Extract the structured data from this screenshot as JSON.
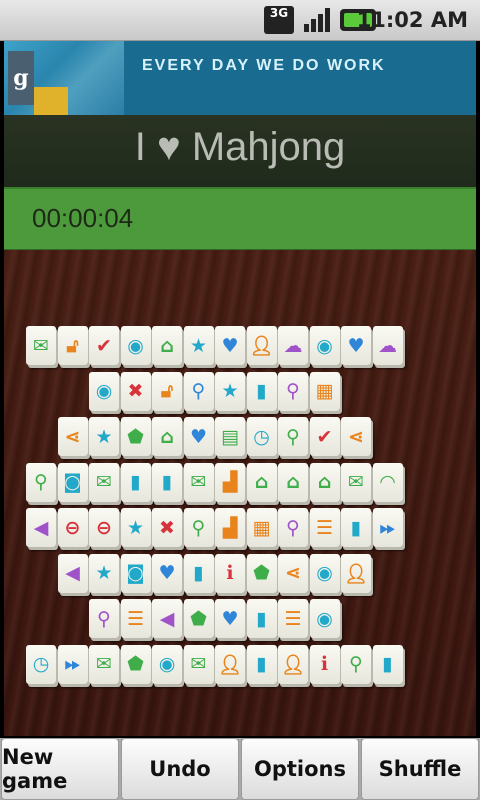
{
  "status_bar": {
    "network_label": "3G",
    "time": "11:02 AM"
  },
  "banner": {
    "logo_letter": "g",
    "tagline": "EVERY DAY WE DO WORK"
  },
  "header": {
    "title_left": "I",
    "title_right": "Mahjong"
  },
  "timer": {
    "value": "00:00:04"
  },
  "colors": {
    "green": "#3fae4a",
    "orange": "#e8841b",
    "red": "#d8333a",
    "teal": "#22a9c9",
    "blue": "#2f86d8",
    "purple": "#a052c8",
    "yellow": "#d7b52a"
  },
  "board": {
    "rows": [
      {
        "row": 0,
        "tiles": [
          {
            "icon": "envelope-icon",
            "glyph": "✉",
            "color": "green"
          },
          {
            "icon": "unlock-icon",
            "glyph": "🔓︎",
            "color": "orange"
          },
          {
            "icon": "check-circle-icon",
            "glyph": "✔",
            "color": "red"
          },
          {
            "icon": "eye-icon",
            "glyph": "◉",
            "color": "teal"
          },
          {
            "icon": "home-icon",
            "glyph": "⌂",
            "color": "green"
          },
          {
            "icon": "star-icon",
            "glyph": "★",
            "color": "teal"
          },
          {
            "icon": "heart-icon",
            "glyph": "♥",
            "color": "blue"
          },
          {
            "icon": "person-icon",
            "glyph": "👤︎",
            "color": "orange"
          },
          {
            "icon": "cloud-download-icon",
            "glyph": "☁",
            "color": "purple"
          },
          {
            "icon": "eye-icon",
            "glyph": "◉",
            "color": "teal"
          },
          {
            "icon": "heart-icon",
            "glyph": "♥",
            "color": "blue"
          },
          {
            "icon": "cloud-download-icon",
            "glyph": "☁",
            "color": "purple"
          }
        ]
      },
      {
        "row": 1,
        "tiles": [
          {
            "icon": "eye-icon",
            "glyph": "◉",
            "color": "teal"
          },
          {
            "icon": "close-icon",
            "glyph": "✖",
            "color": "red"
          },
          {
            "icon": "unlock-icon",
            "glyph": "🔓︎",
            "color": "orange"
          },
          {
            "icon": "pushpin-icon",
            "glyph": "⚲",
            "color": "blue"
          },
          {
            "icon": "star-icon",
            "glyph": "★",
            "color": "teal"
          },
          {
            "icon": "bookmark-icon",
            "glyph": "▮",
            "color": "teal"
          },
          {
            "icon": "map-pin-icon",
            "glyph": "⚲",
            "color": "purple"
          },
          {
            "icon": "grid-icon",
            "glyph": "▦",
            "color": "orange"
          }
        ]
      },
      {
        "row": 2,
        "tiles": [
          {
            "icon": "share-icon",
            "glyph": "⋖",
            "color": "orange"
          },
          {
            "icon": "star-icon",
            "glyph": "★",
            "color": "teal"
          },
          {
            "icon": "tag-icon",
            "glyph": "⬟",
            "color": "green"
          },
          {
            "icon": "home-icon",
            "glyph": "⌂",
            "color": "green"
          },
          {
            "icon": "heart-icon",
            "glyph": "♥",
            "color": "blue"
          },
          {
            "icon": "document-icon",
            "glyph": "▤",
            "color": "green"
          },
          {
            "icon": "clock-icon",
            "glyph": "◷",
            "color": "teal"
          },
          {
            "icon": "search-icon",
            "glyph": "⚲",
            "color": "green"
          },
          {
            "icon": "check-circle-icon",
            "glyph": "✔",
            "color": "red"
          },
          {
            "icon": "share-icon",
            "glyph": "⋖",
            "color": "orange"
          }
        ]
      },
      {
        "row": 3,
        "tiles": [
          {
            "icon": "search-icon",
            "glyph": "⚲",
            "color": "green"
          },
          {
            "icon": "camera-icon",
            "glyph": "◙",
            "color": "teal"
          },
          {
            "icon": "envelope-icon",
            "glyph": "✉",
            "color": "green"
          },
          {
            "icon": "bookmark-icon",
            "glyph": "▮",
            "color": "teal"
          },
          {
            "icon": "bookmark-icon",
            "glyph": "▮",
            "color": "teal"
          },
          {
            "icon": "envelope-icon",
            "glyph": "✉",
            "color": "green"
          },
          {
            "icon": "bar-chart-icon",
            "glyph": "▟",
            "color": "orange"
          },
          {
            "icon": "home-icon",
            "glyph": "⌂",
            "color": "green"
          },
          {
            "icon": "home-icon",
            "glyph": "⌂",
            "color": "green"
          },
          {
            "icon": "home-icon",
            "glyph": "⌂",
            "color": "green"
          },
          {
            "icon": "envelope-icon",
            "glyph": "✉",
            "color": "green"
          },
          {
            "icon": "rss-icon",
            "glyph": "◠",
            "color": "green"
          }
        ]
      },
      {
        "row": 4,
        "tiles": [
          {
            "icon": "speaker-icon",
            "glyph": "◀",
            "color": "purple"
          },
          {
            "icon": "minus-circle-icon",
            "glyph": "⊖",
            "color": "red"
          },
          {
            "icon": "minus-circle-icon",
            "glyph": "⊖",
            "color": "red"
          },
          {
            "icon": "star-icon",
            "glyph": "★",
            "color": "teal"
          },
          {
            "icon": "close-icon",
            "glyph": "✖",
            "color": "red"
          },
          {
            "icon": "search-icon",
            "glyph": "⚲",
            "color": "green"
          },
          {
            "icon": "bar-chart-icon",
            "glyph": "▟",
            "color": "orange"
          },
          {
            "icon": "grid-icon",
            "glyph": "▦",
            "color": "orange"
          },
          {
            "icon": "map-pin-icon",
            "glyph": "⚲",
            "color": "purple"
          },
          {
            "icon": "list-icon",
            "glyph": "☰",
            "color": "orange"
          },
          {
            "icon": "bookmark-icon",
            "glyph": "▮",
            "color": "teal"
          },
          {
            "icon": "fast-forward-icon",
            "glyph": "⏩︎",
            "color": "blue"
          }
        ]
      },
      {
        "row": 5,
        "tiles": [
          {
            "icon": "speaker-icon",
            "glyph": "◀",
            "color": "purple"
          },
          {
            "icon": "star-icon",
            "glyph": "★",
            "color": "teal"
          },
          {
            "icon": "camera-icon",
            "glyph": "◙",
            "color": "teal"
          },
          {
            "icon": "heart-icon",
            "glyph": "♥",
            "color": "blue"
          },
          {
            "icon": "bookmark-icon",
            "glyph": "▮",
            "color": "teal"
          },
          {
            "icon": "info-icon",
            "glyph": "i",
            "color": "red"
          },
          {
            "icon": "tag-icon",
            "glyph": "⬟",
            "color": "green"
          },
          {
            "icon": "share-icon",
            "glyph": "⋖",
            "color": "orange"
          },
          {
            "icon": "eye-icon",
            "glyph": "◉",
            "color": "teal"
          },
          {
            "icon": "person-icon",
            "glyph": "👤︎",
            "color": "orange"
          }
        ]
      },
      {
        "row": 6,
        "tiles": [
          {
            "icon": "map-pin-icon",
            "glyph": "⚲",
            "color": "purple"
          },
          {
            "icon": "list-icon",
            "glyph": "☰",
            "color": "orange"
          },
          {
            "icon": "speaker-icon",
            "glyph": "◀",
            "color": "purple"
          },
          {
            "icon": "tag-icon",
            "glyph": "⬟",
            "color": "green"
          },
          {
            "icon": "heart-icon",
            "glyph": "♥",
            "color": "blue"
          },
          {
            "icon": "bookmark-icon",
            "glyph": "▮",
            "color": "teal"
          },
          {
            "icon": "list-icon",
            "glyph": "☰",
            "color": "orange"
          },
          {
            "icon": "eye-icon",
            "glyph": "◉",
            "color": "teal"
          }
        ]
      },
      {
        "row": 7,
        "tiles": [
          {
            "icon": "clock-icon",
            "glyph": "◷",
            "color": "teal"
          },
          {
            "icon": "fast-forward-icon",
            "glyph": "⏩︎",
            "color": "blue"
          },
          {
            "icon": "envelope-icon",
            "glyph": "✉",
            "color": "green"
          },
          {
            "icon": "tag-icon",
            "glyph": "⬟",
            "color": "green"
          },
          {
            "icon": "eye-icon",
            "glyph": "◉",
            "color": "teal"
          },
          {
            "icon": "envelope-icon",
            "glyph": "✉",
            "color": "green"
          },
          {
            "icon": "person-icon",
            "glyph": "👤︎",
            "color": "orange"
          },
          {
            "icon": "bookmark-icon",
            "glyph": "▮",
            "color": "teal"
          },
          {
            "icon": "person-icon",
            "glyph": "👤︎",
            "color": "orange"
          },
          {
            "icon": "info-icon",
            "glyph": "i",
            "color": "red"
          },
          {
            "icon": "search-icon",
            "glyph": "⚲",
            "color": "green"
          },
          {
            "icon": "bookmark-icon",
            "glyph": "▮",
            "color": "teal"
          }
        ]
      }
    ]
  },
  "buttons": {
    "new_game": "New game",
    "undo": "Undo",
    "options": "Options",
    "shuffle": "Shuffle"
  }
}
